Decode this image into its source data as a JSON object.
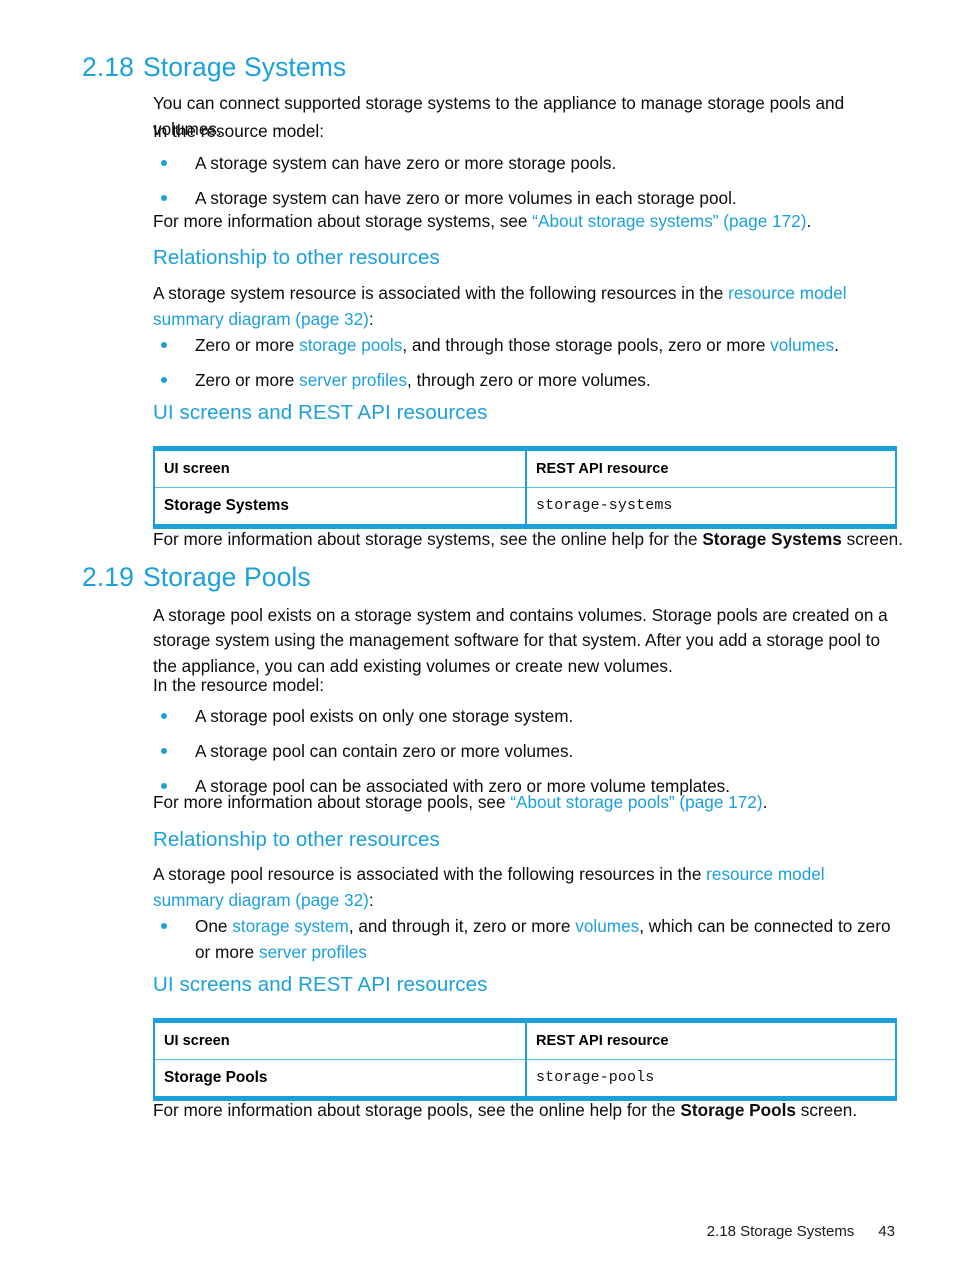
{
  "sections": [
    {
      "number": "2.18",
      "title": "Storage Systems",
      "intro_line1": "You can connect supported storage systems to the appliance to manage storage pools and volumes.",
      "intro_line2": "In the resource model:",
      "bullets": [
        "A storage system can have zero or more storage pools.",
        "A storage system can have zero or more volumes in each storage pool."
      ],
      "more_info_prefix": "For more information about storage systems, see ",
      "more_info_link": "“About storage systems” (page 172)",
      "more_info_suffix": ".",
      "relationship_heading": "Relationship to other resources",
      "relationship_intro_a": "A storage system resource is associated with the following resources in the ",
      "relationship_intro_link": "resource model summary diagram (page 32)",
      "relationship_intro_b": ":",
      "relationship_bullets": [
        {
          "p1": "Zero or more ",
          "l1": "storage pools",
          "p2": ", and through those storage pools, zero or more ",
          "l2": "volumes",
          "p3": "."
        },
        {
          "p1": "Zero or more ",
          "l1": "server profiles",
          "p2": ", through zero or more volumes.",
          "l2": "",
          "p3": ""
        }
      ],
      "table_heading": "UI screens and REST API resources",
      "table": {
        "headers": [
          "UI screen",
          "REST API resource"
        ],
        "rows": [
          [
            "Storage Systems",
            "storage-systems"
          ]
        ]
      },
      "closing_prefix": "For more information about storage systems, see the online help for the ",
      "closing_bold": "Storage Systems",
      "closing_suffix": " screen."
    },
    {
      "number": "2.19",
      "title": "Storage Pools",
      "intro_line1": "A storage pool exists on a storage system and contains volumes. Storage pools are created on a storage system using the management software for that system. After you add a storage pool to the appliance, you can add existing volumes or create new volumes.",
      "intro_line2": "In the resource model:",
      "bullets": [
        "A storage pool exists on only one storage system.",
        "A storage pool can contain zero or more volumes.",
        "A storage pool can be associated with zero or more volume templates."
      ],
      "more_info_prefix": "For more information about storage pools, see ",
      "more_info_link": "“About storage pools” (page 172)",
      "more_info_suffix": ".",
      "relationship_heading": "Relationship to other resources",
      "relationship_intro_a": "A storage pool resource is associated with the following resources in the ",
      "relationship_intro_link": "resource model summary diagram (page 32)",
      "relationship_intro_b": ":",
      "relationship_bullets": [
        {
          "p1": "One ",
          "l1": "storage system",
          "p2": ", and through it, zero or more ",
          "l2": "volumes",
          "p3": ", which can be connected to zero or more ",
          "l3": "server profiles"
        }
      ],
      "table_heading": "UI screens and REST API resources",
      "table": {
        "headers": [
          "UI screen",
          "REST API resource"
        ],
        "rows": [
          [
            "Storage Pools",
            "storage-pools"
          ]
        ]
      },
      "closing_prefix": "For more information about storage pools, see the online help for the ",
      "closing_bold": "Storage Pools",
      "closing_suffix": " screen."
    }
  ],
  "footer": {
    "running_head": "2.18 Storage Systems",
    "page_number": "43"
  },
  "colors": {
    "accent": "#1ba0dc",
    "text": "#0d0d0d",
    "table_rule": "#5bbfe8"
  }
}
